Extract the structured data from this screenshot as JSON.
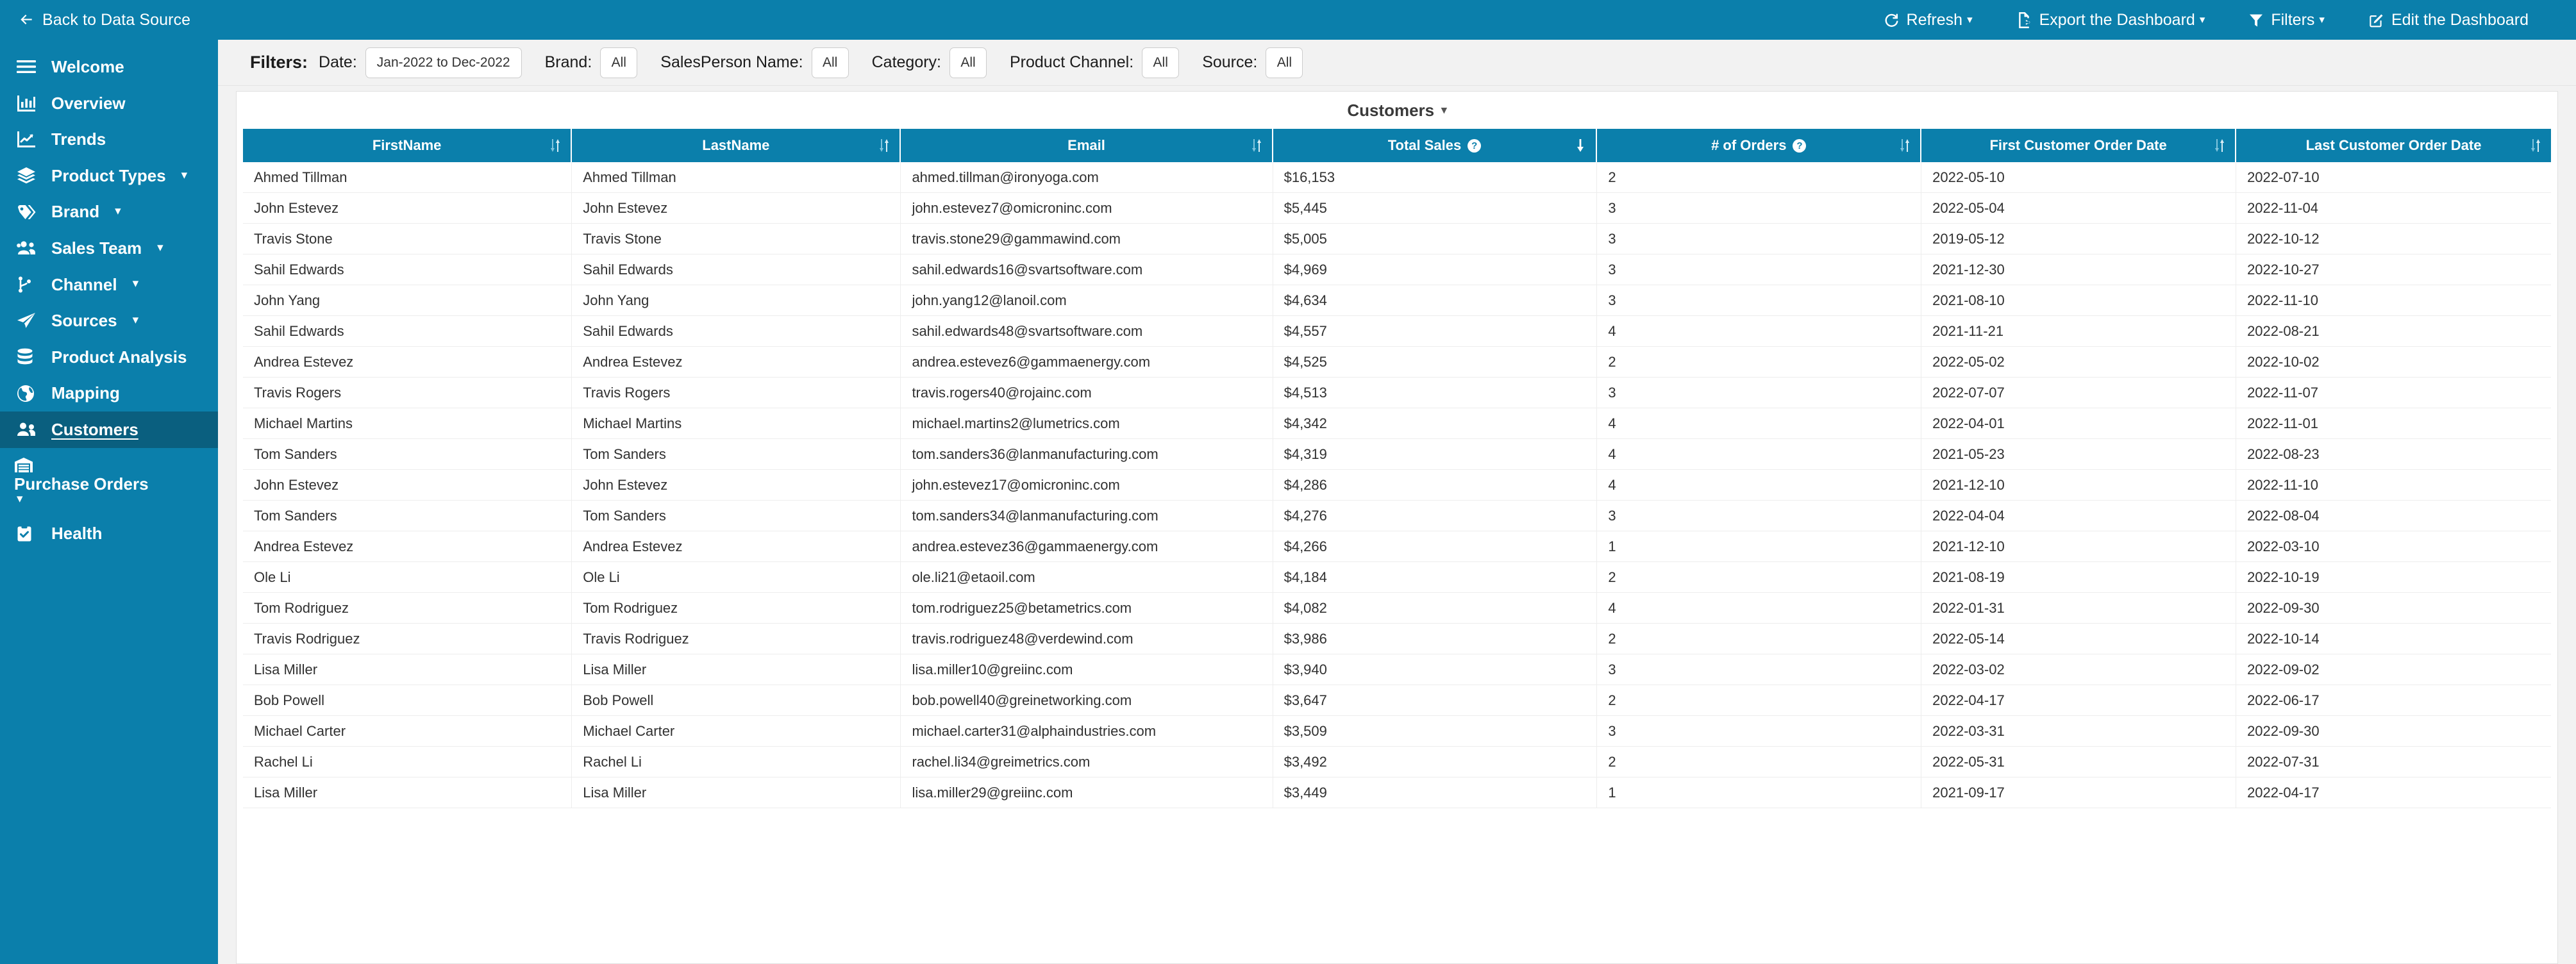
{
  "topbar": {
    "back_label": "Back to Data Source",
    "back_icon": "arrow-left-icon",
    "actions": [
      {
        "label": "Refresh",
        "icon": "refresh-icon",
        "caret": "▾"
      },
      {
        "label": "Export the Dashboard",
        "icon": "export-file-icon",
        "caret": "▾"
      },
      {
        "label": "Filters",
        "icon": "funnel-icon",
        "caret": "▾"
      },
      {
        "label": "Edit the Dashboard",
        "icon": "edit-pencil-icon",
        "caret": ""
      }
    ]
  },
  "sidebar": {
    "items": [
      {
        "label": "Welcome",
        "icon": "hamburger-icon",
        "caret": false,
        "active": false
      },
      {
        "label": "Overview",
        "icon": "bar-chart-icon",
        "caret": false,
        "active": false
      },
      {
        "label": "Trends",
        "icon": "line-chart-icon",
        "caret": false,
        "active": false
      },
      {
        "label": "Product Types",
        "icon": "layers-icon",
        "caret": true,
        "active": false
      },
      {
        "label": "Brand",
        "icon": "tag-icon",
        "caret": true,
        "active": false
      },
      {
        "label": "Sales Team",
        "icon": "users-group-icon",
        "caret": true,
        "active": false
      },
      {
        "label": "Channel",
        "icon": "code-branch-icon",
        "caret": true,
        "active": false
      },
      {
        "label": "Sources",
        "icon": "paper-plane-icon",
        "caret": true,
        "active": false
      },
      {
        "label": "Product Analysis",
        "icon": "database-icon",
        "caret": false,
        "active": false
      },
      {
        "label": "Mapping",
        "icon": "globe-icon",
        "caret": false,
        "active": false
      },
      {
        "label": "Customers",
        "icon": "users-icon",
        "caret": false,
        "active": true
      },
      {
        "label": "Purchase Orders",
        "icon": "warehouse-icon",
        "caret": true,
        "active": false,
        "wrap": true
      },
      {
        "label": "Health",
        "icon": "clipboard-check-icon",
        "caret": false,
        "active": false
      }
    ]
  },
  "filters": {
    "title": "Filters:",
    "fields": [
      {
        "label": "Date:",
        "value": "Jan-2022 to Dec-2022",
        "small": false
      },
      {
        "label": "Brand:",
        "value": "All",
        "small": true
      },
      {
        "label": "SalesPerson Name:",
        "value": "All",
        "small": true
      },
      {
        "label": "Category:",
        "value": "All",
        "small": true
      },
      {
        "label": "Product Channel:",
        "value": "All",
        "small": true
      },
      {
        "label": "Source:",
        "value": "All",
        "small": true
      }
    ]
  },
  "card": {
    "title": "Customers",
    "caret": "▾"
  },
  "table": {
    "columns": [
      {
        "label": "FirstName",
        "help": false,
        "sort": "both"
      },
      {
        "label": "LastName",
        "help": false,
        "sort": "both"
      },
      {
        "label": "Email",
        "help": false,
        "sort": "both"
      },
      {
        "label": "Total Sales",
        "help": true,
        "sort": "desc"
      },
      {
        "label": "# of Orders",
        "help": true,
        "sort": "both"
      },
      {
        "label": "First Customer Order Date",
        "help": false,
        "sort": "both"
      },
      {
        "label": "Last Customer Order Date",
        "help": false,
        "sort": "both"
      }
    ],
    "rows": [
      [
        "Ahmed Tillman",
        "Ahmed Tillman",
        "ahmed.tillman@ironyoga.com",
        "$16,153",
        "2",
        "2022-05-10",
        "2022-07-10"
      ],
      [
        "John Estevez",
        "John Estevez",
        "john.estevez7@omicroninc.com",
        "$5,445",
        "3",
        "2022-05-04",
        "2022-11-04"
      ],
      [
        "Travis Stone",
        "Travis Stone",
        "travis.stone29@gammawind.com",
        "$5,005",
        "3",
        "2019-05-12",
        "2022-10-12"
      ],
      [
        "Sahil Edwards",
        "Sahil Edwards",
        "sahil.edwards16@svartsoftware.com",
        "$4,969",
        "3",
        "2021-12-30",
        "2022-10-27"
      ],
      [
        "John Yang",
        "John Yang",
        "john.yang12@lanoil.com",
        "$4,634",
        "3",
        "2021-08-10",
        "2022-11-10"
      ],
      [
        "Sahil Edwards",
        "Sahil Edwards",
        "sahil.edwards48@svartsoftware.com",
        "$4,557",
        "4",
        "2021-11-21",
        "2022-08-21"
      ],
      [
        "Andrea Estevez",
        "Andrea Estevez",
        "andrea.estevez6@gammaenergy.com",
        "$4,525",
        "2",
        "2022-05-02",
        "2022-10-02"
      ],
      [
        "Travis Rogers",
        "Travis Rogers",
        "travis.rogers40@rojainc.com",
        "$4,513",
        "3",
        "2022-07-07",
        "2022-11-07"
      ],
      [
        "Michael Martins",
        "Michael Martins",
        "michael.martins2@lumetrics.com",
        "$4,342",
        "4",
        "2022-04-01",
        "2022-11-01"
      ],
      [
        "Tom Sanders",
        "Tom Sanders",
        "tom.sanders36@lanmanufacturing.com",
        "$4,319",
        "4",
        "2021-05-23",
        "2022-08-23"
      ],
      [
        "John Estevez",
        "John Estevez",
        "john.estevez17@omicroninc.com",
        "$4,286",
        "4",
        "2021-12-10",
        "2022-11-10"
      ],
      [
        "Tom Sanders",
        "Tom Sanders",
        "tom.sanders34@lanmanufacturing.com",
        "$4,276",
        "3",
        "2022-04-04",
        "2022-08-04"
      ],
      [
        "Andrea Estevez",
        "Andrea Estevez",
        "andrea.estevez36@gammaenergy.com",
        "$4,266",
        "1",
        "2021-12-10",
        "2022-03-10"
      ],
      [
        "Ole Li",
        "Ole Li",
        "ole.li21@etaoil.com",
        "$4,184",
        "2",
        "2021-08-19",
        "2022-10-19"
      ],
      [
        "Tom Rodriguez",
        "Tom Rodriguez",
        "tom.rodriguez25@betametrics.com",
        "$4,082",
        "4",
        "2022-01-31",
        "2022-09-30"
      ],
      [
        "Travis Rodriguez",
        "Travis Rodriguez",
        "travis.rodriguez48@verdewind.com",
        "$3,986",
        "2",
        "2022-05-14",
        "2022-10-14"
      ],
      [
        "Lisa Miller",
        "Lisa Miller",
        "lisa.miller10@greiinc.com",
        "$3,940",
        "3",
        "2022-03-02",
        "2022-09-02"
      ],
      [
        "Bob Powell",
        "Bob Powell",
        "bob.powell40@greinetworking.com",
        "$3,647",
        "2",
        "2022-04-17",
        "2022-06-17"
      ],
      [
        "Michael Carter",
        "Michael Carter",
        "michael.carter31@alphaindustries.com",
        "$3,509",
        "3",
        "2022-03-31",
        "2022-09-30"
      ],
      [
        "Rachel Li",
        "Rachel Li",
        "rachel.li34@greimetrics.com",
        "$3,492",
        "2",
        "2022-05-31",
        "2022-07-31"
      ],
      [
        "Lisa Miller",
        "Lisa Miller",
        "lisa.miller29@greiinc.com",
        "$3,449",
        "1",
        "2021-09-17",
        "2022-04-17"
      ]
    ]
  },
  "colors": {
    "brand": "#0b7fab",
    "brand_active": "#0a5f7f",
    "page_bg": "#f2f2f2"
  }
}
